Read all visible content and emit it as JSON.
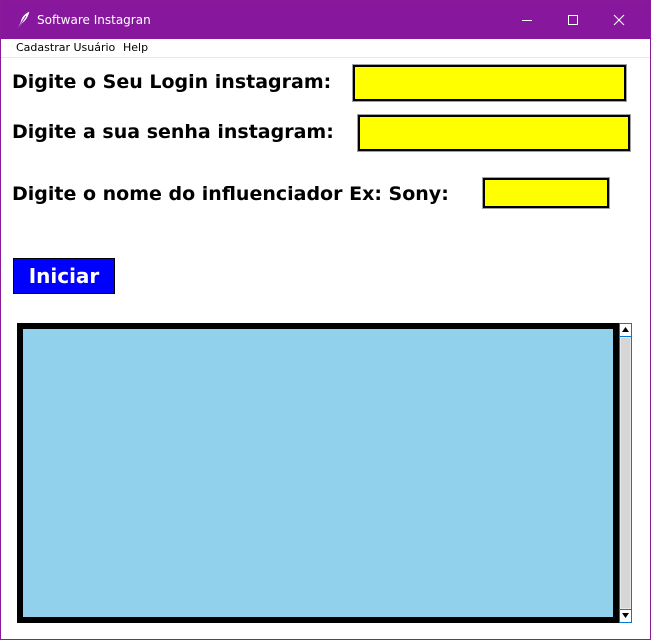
{
  "window": {
    "title": "Software Instagran",
    "titlebar_color": "#87189d",
    "controls": {
      "minimize_icon": "minimize-icon",
      "maximize_icon": "maximize-icon",
      "close_icon": "close-icon"
    }
  },
  "menu": {
    "items": [
      {
        "label": "Cadastrar Usuário"
      },
      {
        "label": "Help"
      }
    ]
  },
  "form": {
    "login_label": "Digite o Seu Login instagram:",
    "login_value": "",
    "senha_label": "Digite a sua senha instagram:",
    "senha_value": "",
    "influenciador_label": "Digite o nome do influenciador Ex: Sony:",
    "influenciador_value": "",
    "input_color": "#ffff00"
  },
  "actions": {
    "iniciar_label": "Iniciar",
    "button_color": "#0000ff"
  },
  "output": {
    "text": "",
    "background_color": "#92d1ec"
  }
}
